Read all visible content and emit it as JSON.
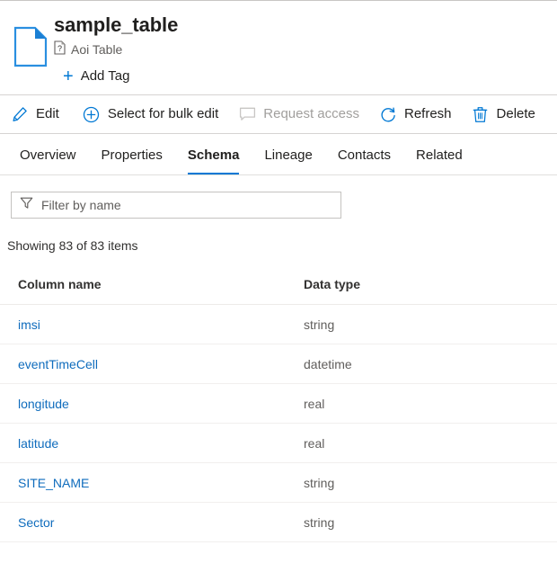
{
  "asset": {
    "title": "sample_table",
    "type_label": "Aoi Table",
    "type_icon": "document-question-icon",
    "asset_icon": "file-document-icon",
    "add_tag_label": "Add Tag",
    "add_tag_icon": "plus-icon"
  },
  "commandbar": {
    "items": [
      {
        "label": "Edit",
        "icon": "pencil-icon",
        "disabled": false
      },
      {
        "label": "Select for bulk edit",
        "icon": "circle-plus-icon",
        "disabled": false
      },
      {
        "label": "Request access",
        "icon": "comment-icon",
        "disabled": true
      },
      {
        "label": "Refresh",
        "icon": "refresh-icon",
        "disabled": false
      },
      {
        "label": "Delete",
        "icon": "trash-icon",
        "disabled": false
      }
    ]
  },
  "tabs": {
    "items": [
      {
        "label": "Overview",
        "active": false
      },
      {
        "label": "Properties",
        "active": false
      },
      {
        "label": "Schema",
        "active": true
      },
      {
        "label": "Lineage",
        "active": false
      },
      {
        "label": "Contacts",
        "active": false
      },
      {
        "label": "Related",
        "active": false
      }
    ]
  },
  "filter": {
    "placeholder": "Filter by name",
    "value": "",
    "icon": "funnel-filter-icon"
  },
  "results": {
    "showing_text": "Showing 83 of 83 items",
    "shown_count": 83,
    "total_count": 83
  },
  "schema": {
    "headers": {
      "column_name": "Column name",
      "data_type": "Data type"
    },
    "rows": [
      {
        "column_name": "imsi",
        "data_type": "string"
      },
      {
        "column_name": "eventTimeCell",
        "data_type": "datetime"
      },
      {
        "column_name": "longitude",
        "data_type": "real"
      },
      {
        "column_name": "latitude",
        "data_type": "real"
      },
      {
        "column_name": "SITE_NAME",
        "data_type": "string"
      },
      {
        "column_name": "Sector",
        "data_type": "string"
      }
    ]
  },
  "colors": {
    "accent": "#0078d4",
    "link": "#0f6cbd",
    "text": "#323130",
    "muted": "#605e5c",
    "disabled": "#a19f9d",
    "border": "#c8c6c4"
  }
}
